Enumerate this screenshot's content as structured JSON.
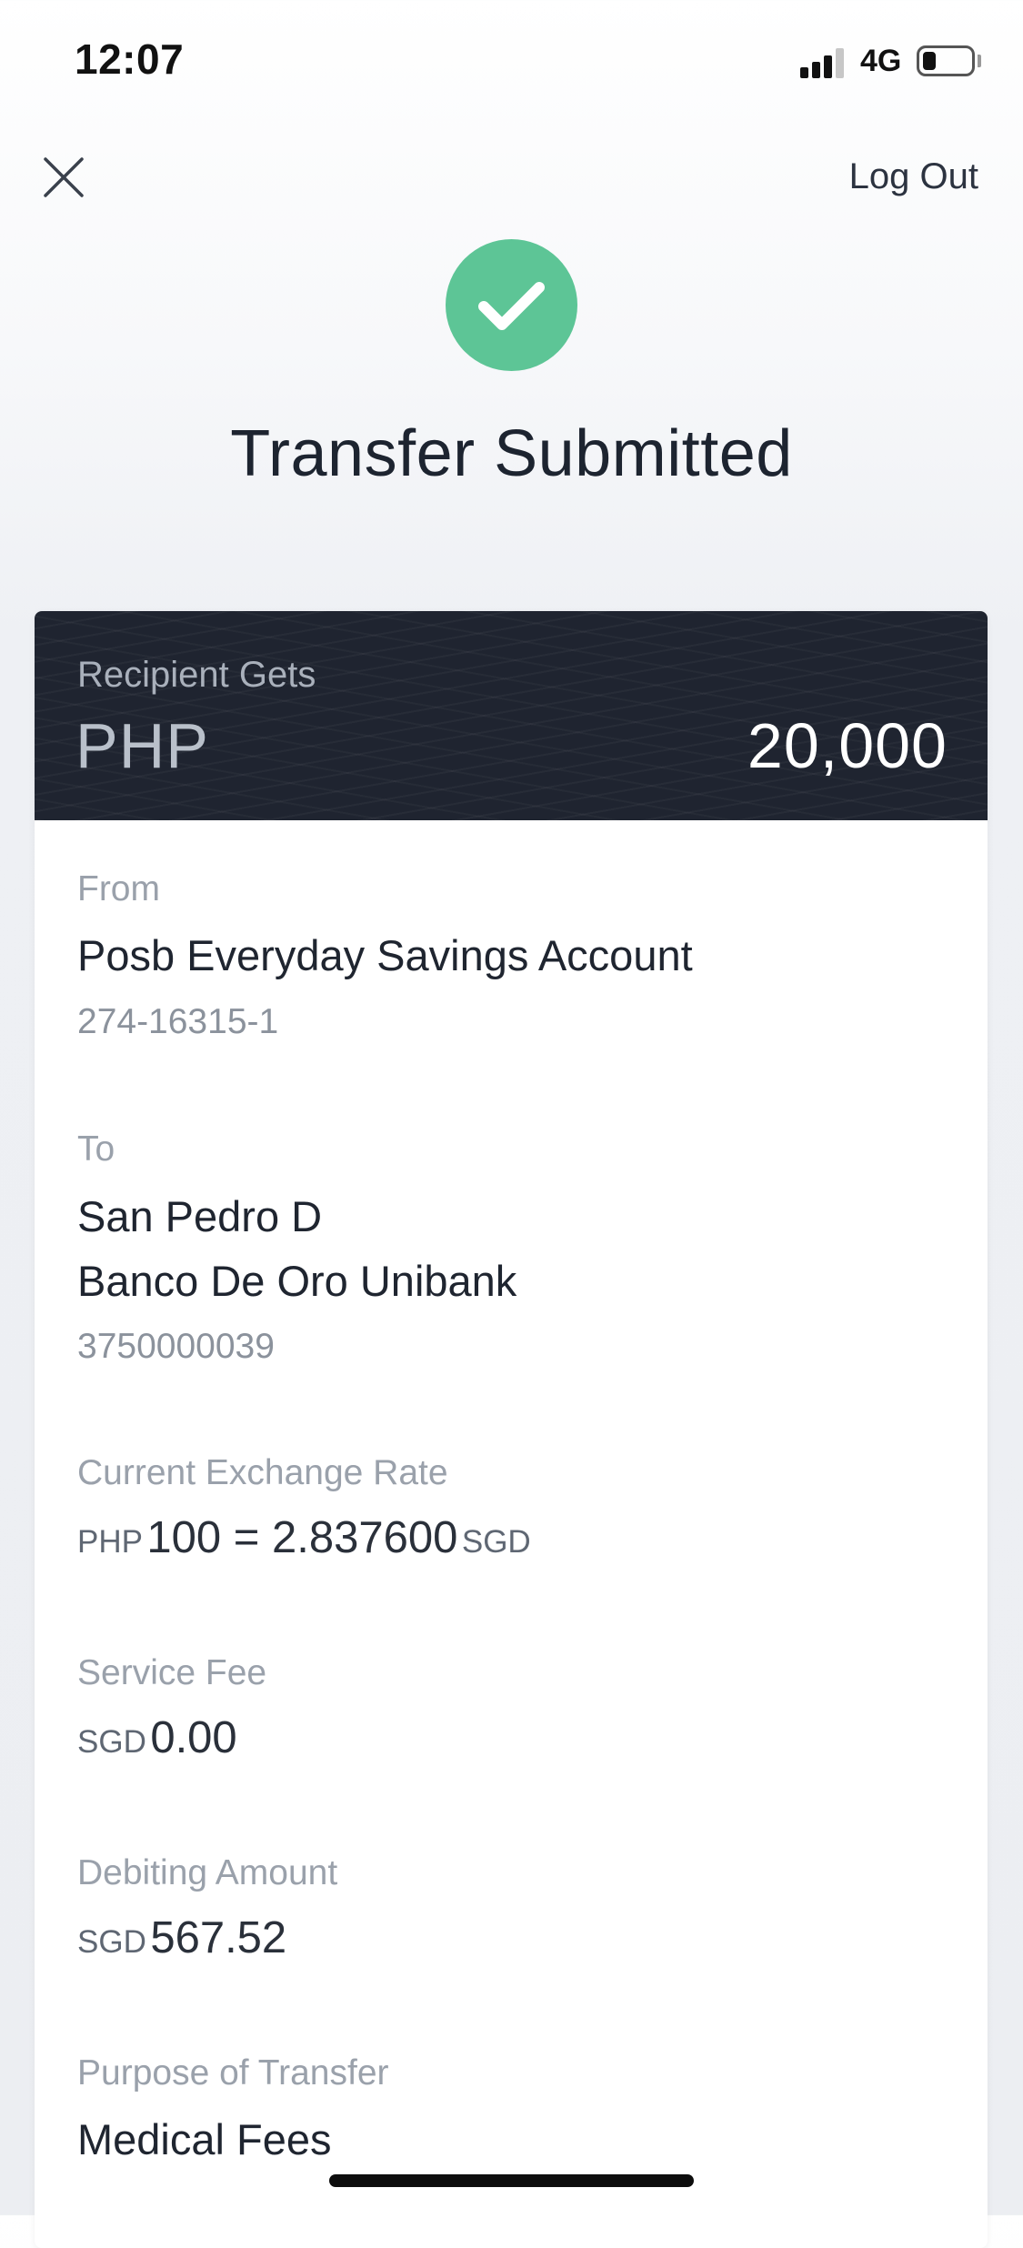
{
  "status_bar": {
    "time": "12:07",
    "network": "4G",
    "battery_level": 0.2
  },
  "nav": {
    "close_icon": "close-icon",
    "logout_label": "Log Out"
  },
  "header": {
    "success_icon": "checkmark-icon",
    "success_color": "#5dc596",
    "title": "Transfer Submitted"
  },
  "recipient_gets": {
    "label": "Recipient Gets",
    "currency": "PHP",
    "amount": "20,000"
  },
  "from": {
    "label": "From",
    "account_name": "Posb Everyday Savings Account",
    "account_number": "274-16315-1"
  },
  "to": {
    "label": "To",
    "name": "San Pedro D",
    "bank": "Banco De Oro Unibank",
    "account_number": "3750000039"
  },
  "exchange_rate": {
    "label": "Current Exchange Rate",
    "from_currency": "PHP",
    "value_text": "100 = 2.837600",
    "to_currency": "SGD"
  },
  "service_fee": {
    "label": "Service Fee",
    "currency": "SGD",
    "amount": "0.00"
  },
  "debiting_amount": {
    "label": "Debiting Amount",
    "currency": "SGD",
    "amount": "567.52"
  },
  "purpose": {
    "label": "Purpose of Transfer",
    "value": "Medical Fees"
  }
}
